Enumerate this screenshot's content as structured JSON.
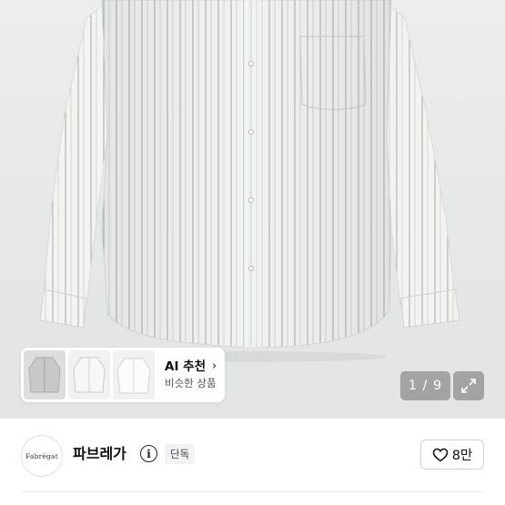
{
  "gallery": {
    "image_alt_icon": "product-shirt-image",
    "counter": "1 / 9",
    "expand_icon": "expand-arrows-icon"
  },
  "ai_recommend": {
    "title": "AI 추천",
    "chevron": "›",
    "subtitle": "비슷한 상품",
    "thumbnails": [
      {
        "icon": "gray-shirt-thumbnail"
      },
      {
        "icon": "white-shirt-thumbnail"
      },
      {
        "icon": "white-shirt-thumbnail"
      }
    ]
  },
  "brand": {
    "logo_text": "Fabrégat",
    "name": "파브레가",
    "info_icon": "i",
    "badge": "단독"
  },
  "like": {
    "icon": "heart-icon",
    "count": "8만"
  },
  "colors": {
    "overlay": "#6e7070",
    "badge_bg": "#f1f2f4",
    "border": "#d2d2d2"
  }
}
